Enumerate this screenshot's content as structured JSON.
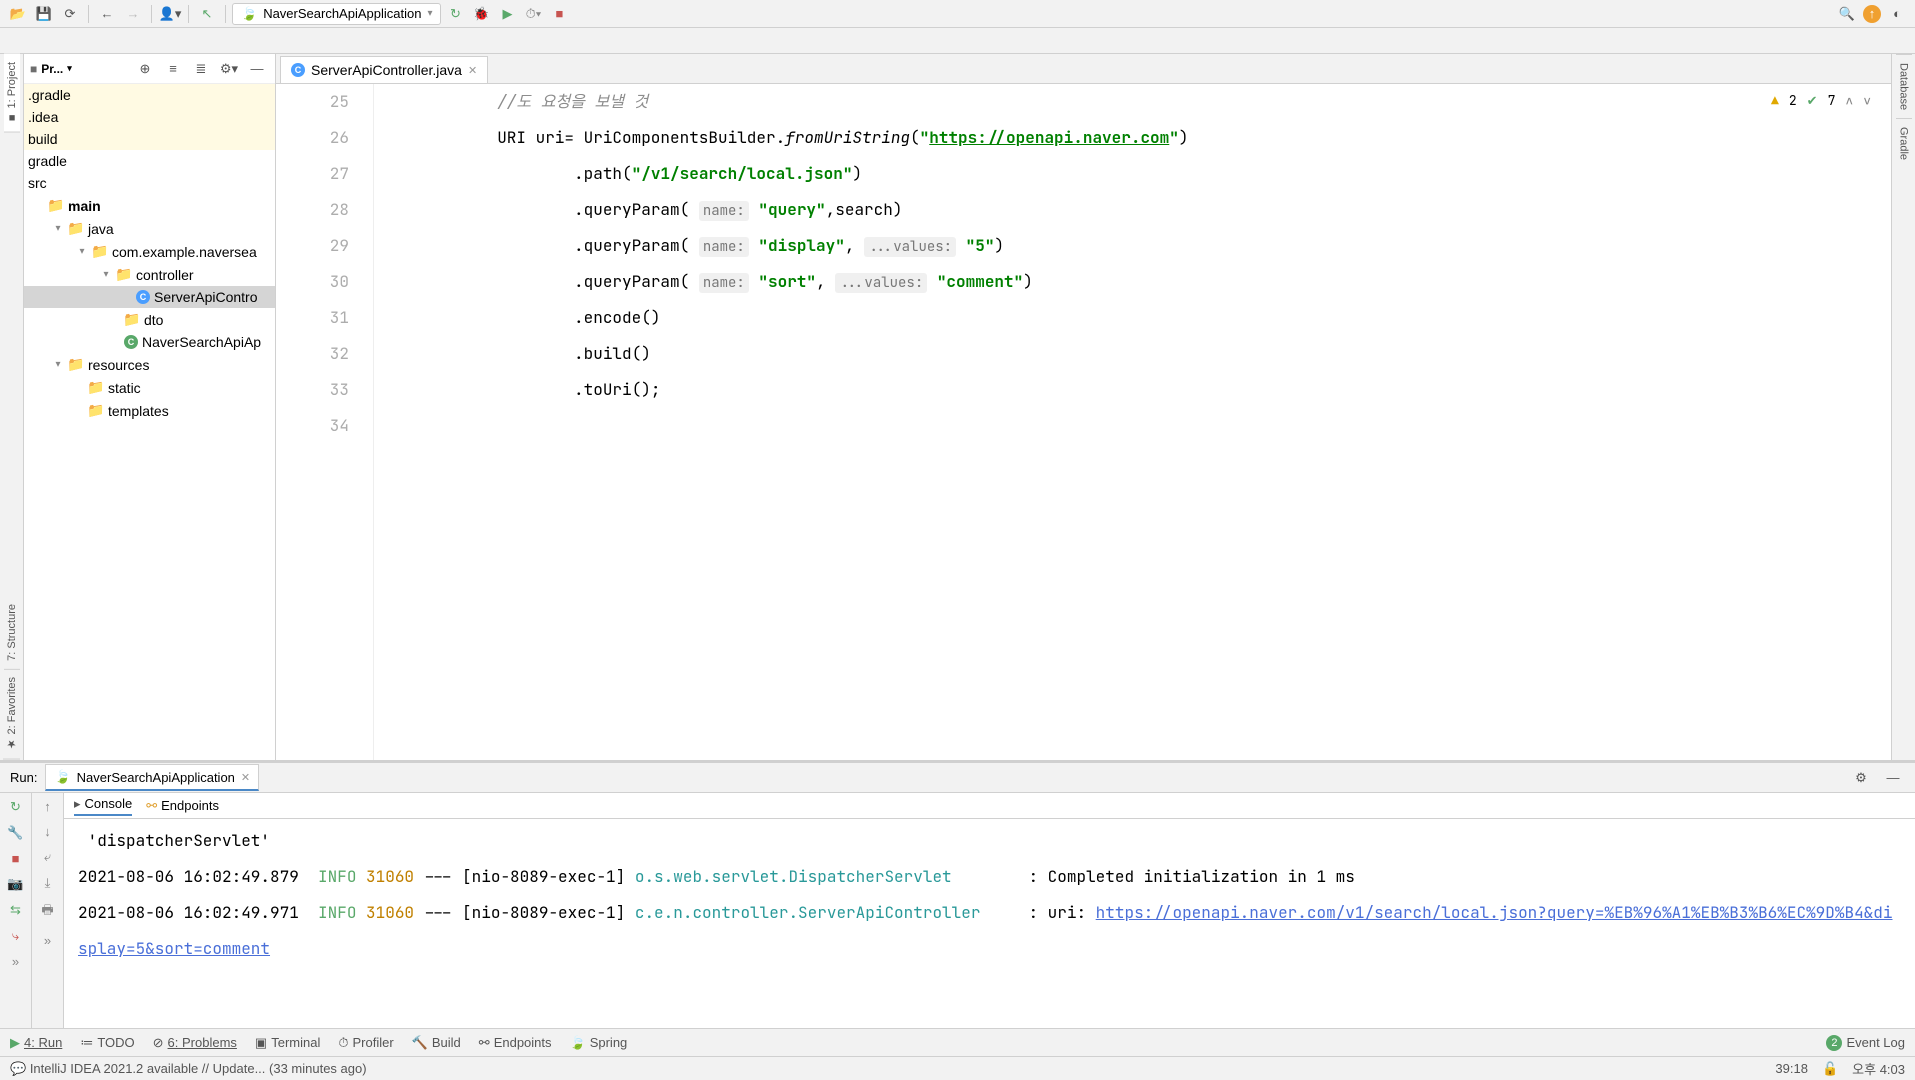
{
  "toolbar": {
    "run_config": "NaverSearchApiApplication"
  },
  "project": {
    "title": "Pr...",
    "tree": {
      "gradle_dot": ".gradle",
      "idea": ".idea",
      "build": "build",
      "gradle": "gradle",
      "src": "src",
      "main": "main",
      "java": "java",
      "package": "com.example.naversea",
      "controller": "controller",
      "controller_file": "ServerApiContro",
      "dto": "dto",
      "app_file": "NaverSearchApiAp",
      "resources": "resources",
      "static": "static",
      "templates": "templates"
    }
  },
  "editor": {
    "tab": "ServerApiController.java",
    "inspection": {
      "warnings": "2",
      "checks": "7"
    },
    "lines": [
      "25",
      "26",
      "27",
      "28",
      "29",
      "30",
      "31",
      "32",
      "33",
      "34"
    ],
    "code": {
      "l25": "//도 요청을 보낼 것",
      "l26_pre": "URI uri= UriComponentsBuilder.",
      "l26_method": "fromUriString",
      "l26_open": "(",
      "l26_q1": "\"",
      "l26_url": "https://openapi.naver.com",
      "l26_q2": "\"",
      "l26_close": ")",
      "l27_method": ".path(",
      "l27_str": "\"/v1/search/local.json\"",
      "l27_close": ")",
      "l28_method": ".queryParam(",
      "l28_hint": "name:",
      "l28_str": " \"query\"",
      "l28_rest": ",search)",
      "l29_method": ".queryParam(",
      "l29_h1": "name:",
      "l29_s1": " \"display\"",
      "l29_comma": ", ",
      "l29_h2": "...values:",
      "l29_s2": " \"5\"",
      "l29_close": ")",
      "l30_method": ".queryParam(",
      "l30_h1": "name:",
      "l30_s1": " \"sort\"",
      "l30_comma": ", ",
      "l30_h2": "...values:",
      "l30_s2": " \"comment\"",
      "l30_close": ")",
      "l31": ".encode()",
      "l32": ".build()",
      "l33": ".toUri();"
    }
  },
  "run": {
    "label": "Run:",
    "config": "NaverSearchApiApplication",
    "tabs": {
      "console": "Console",
      "endpoints": "Endpoints"
    },
    "log": {
      "line0": "'dispatcherServlet'",
      "ts1": "2021-08-06 16:02:49.879",
      "info": "INFO",
      "pid": "31060",
      "thread": " --- [nio-8089-exec-1] ",
      "class1": "o.s.web.servlet.DispatcherServlet",
      "msg1": "        : Completed initialization in 1 ms",
      "ts2": "2021-08-06 16:02:49.971",
      "class2": "c.e.n.controller.ServerApiController",
      "msg2_pre": "     : uri: ",
      "url": "https://openapi.naver.com/v1/search/local.json?query=%EB%96%A1%EB%B3%B6%EC%9D%B4&display=5&sort=comment"
    }
  },
  "bottom_tabs": {
    "run": "4: Run",
    "todo": "TODO",
    "problems": "6: Problems",
    "terminal": "Terminal",
    "profiler": "Profiler",
    "build": "Build",
    "endpoints": "Endpoints",
    "spring": "Spring",
    "eventlog": "Event Log"
  },
  "left_tabs": {
    "project": "1: Project",
    "structure": "7: Structure",
    "favorites": "2: Favorites"
  },
  "right_tabs": {
    "database": "Database",
    "gradle": "Gradle"
  },
  "status": {
    "message": "IntelliJ IDEA 2021.2 available // Update... (33 minutes ago)",
    "pos": "39:18",
    "time": "오후 4:03"
  },
  "eventlog_badge": "2"
}
